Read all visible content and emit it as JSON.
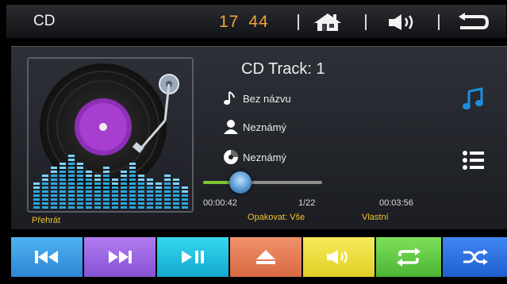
{
  "header": {
    "title": "CD",
    "clock_hours": "17",
    "clock_minutes": "44"
  },
  "track": {
    "title": "CD Track: 1",
    "song": "Bez názvu",
    "artist": "Neznámý",
    "album": "Neznámý"
  },
  "progress": {
    "elapsed": "00:00:42",
    "track_counter": "1/22",
    "total": "00:03:56",
    "fraction": 0.18
  },
  "status": {
    "mode": "Přehrát",
    "repeat": "Opakovat: Vše",
    "custom": "Vlastní"
  },
  "icons": {
    "home": "home-icon",
    "volume": "volume-icon",
    "back": "back-icon",
    "music_note": "music-note-icon",
    "list": "list-icon"
  },
  "bottom_buttons": [
    "previous-track",
    "next-track",
    "play-pause",
    "eject",
    "volume",
    "repeat",
    "shuffle"
  ],
  "colors": {
    "clock": "#f0a23a",
    "status_text": "#f2c230",
    "accent_blue": "#1c8fe0",
    "progress": "#7fc430"
  }
}
